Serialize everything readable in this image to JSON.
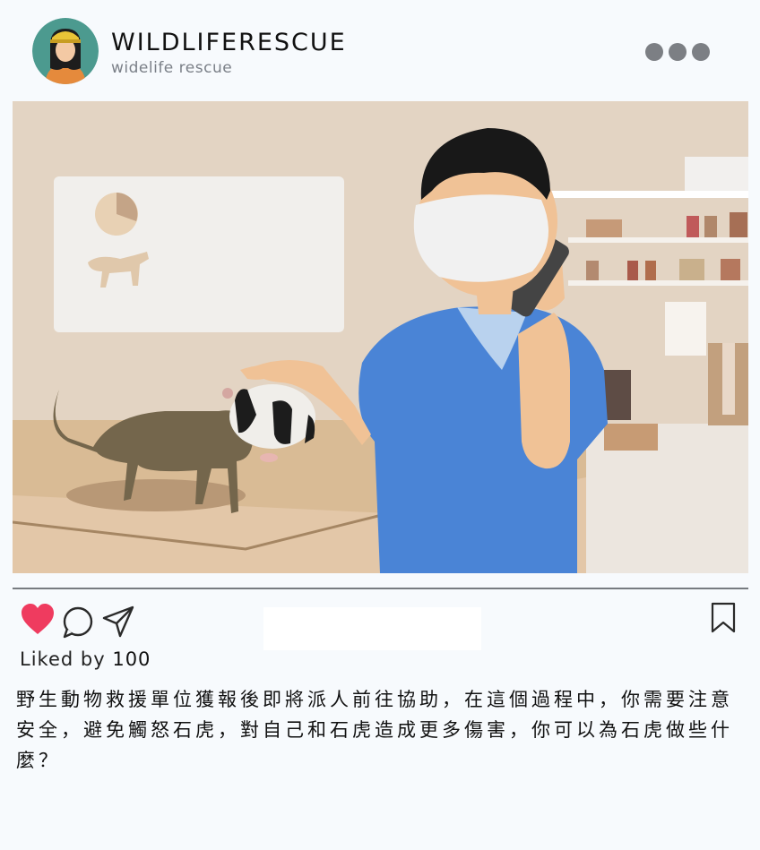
{
  "post": {
    "username": "WILDLIFERESCUE",
    "subname": "widelife rescue",
    "likes_prefix": "Liked by",
    "likes_count": "100",
    "caption": "野生動物救援單位獲報後即將派人前往協助，在這個過程中，你需要注意安全，避免觸怒石虎，對自己和石虎造成更多傷害，你可以為石虎做些什麼？"
  },
  "icons": {
    "more": "more-dots-icon",
    "like": "heart-icon",
    "comment": "comment-bubble-icon",
    "share": "paper-plane-icon",
    "save": "bookmark-icon"
  },
  "colors": {
    "heart": "#ef3b5f",
    "text": "#111111",
    "scrubs": "#4a84d6",
    "wall": "#e2d3c2"
  }
}
